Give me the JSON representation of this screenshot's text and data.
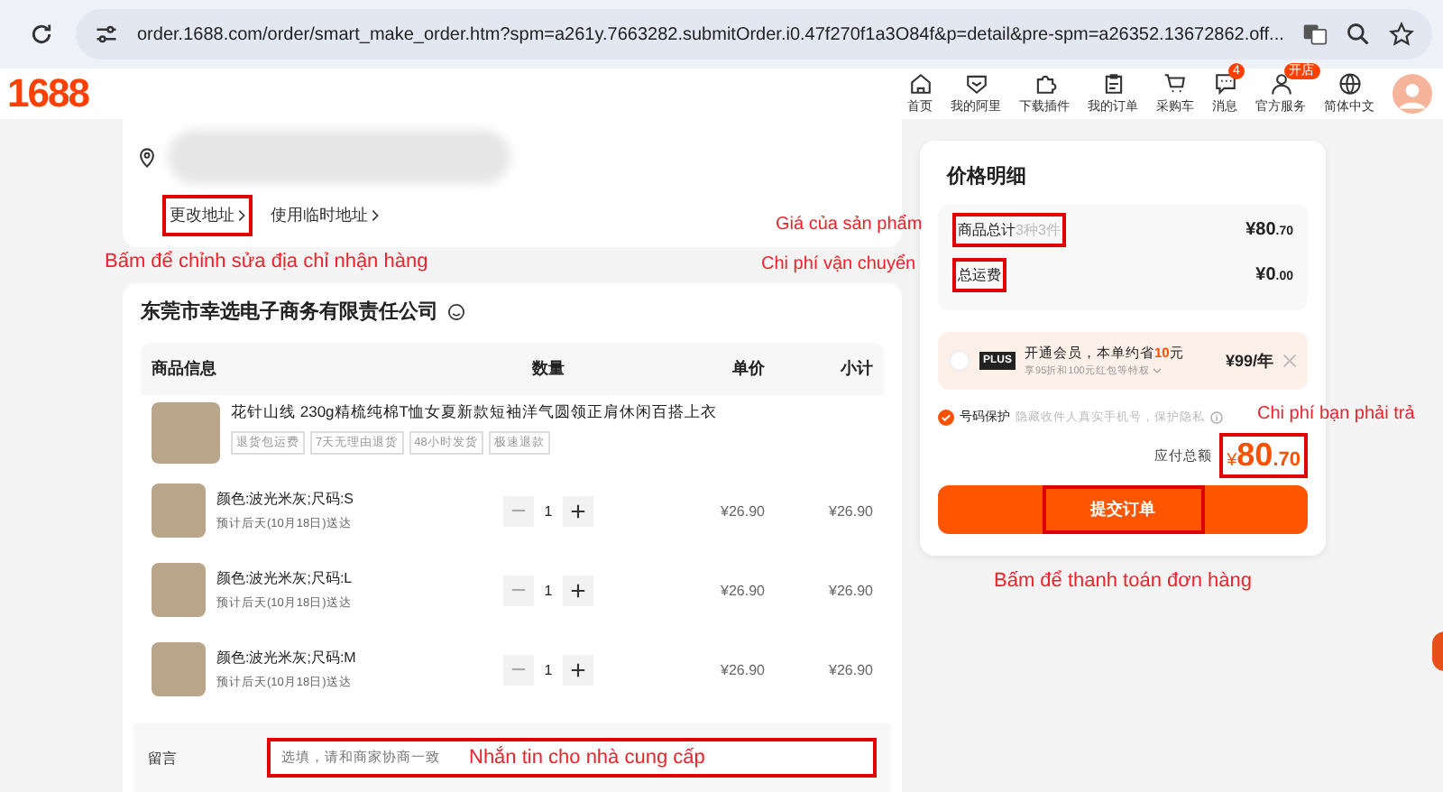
{
  "browser": {
    "url": "order.1688.com/order/smart_make_order.htm?spm=a261y.7663282.submitOrder.i0.47f270f1a3O84f&p=detail&pre-spm=a26352.13672862.off..."
  },
  "header": {
    "logo": "1688",
    "nav": [
      {
        "label": "首页"
      },
      {
        "label": "我的阿里"
      },
      {
        "label": "下载插件"
      },
      {
        "label": "我的订单"
      },
      {
        "label": "采购车"
      },
      {
        "label": "消息",
        "badge": "4"
      },
      {
        "label": "官方服务",
        "badge": "开店"
      },
      {
        "label": "简体中文"
      }
    ]
  },
  "address": {
    "links": [
      {
        "label": "更改地址",
        "highlighted": true
      },
      {
        "label": "使用临时地址",
        "highlighted": false
      }
    ],
    "annotation": "Bấm để chỉnh sửa địa chỉ nhận hàng"
  },
  "store": {
    "name": "东莞市幸选电子商务有限责任公司",
    "columns": [
      "商品信息",
      "数量",
      "单价",
      "小计"
    ],
    "product": {
      "title": "花针山线 230g精梳纯棉T恤女夏新款短袖洋气圆领正肩休闲百搭上衣",
      "tags": [
        "退货包运费",
        "7天无理由退货",
        "48小时发货",
        "极速退款"
      ]
    },
    "items": [
      {
        "variant": "颜色:波光米灰;尺码:S",
        "delivery": "预计后天(10月18日)送达",
        "qty": "1",
        "price": "¥26.90",
        "subtotal": "¥26.90"
      },
      {
        "variant": "颜色:波光米灰;尺码:L",
        "delivery": "预计后天(10月18日)送达",
        "qty": "1",
        "price": "¥26.90",
        "subtotal": "¥26.90"
      },
      {
        "variant": "颜色:波光米灰;尺码:M",
        "delivery": "预计后天(10月18日)送达",
        "qty": "1",
        "price": "¥26.90",
        "subtotal": "¥26.90"
      }
    ],
    "message": {
      "label": "留言",
      "placeholder": "选填，请和商家协商一致",
      "annotation": "Nhắn tin cho nhà cung cấp"
    }
  },
  "summary": {
    "title": "价格明细",
    "rows": [
      {
        "label": "商品总计",
        "note": "3种3件",
        "integer": "¥80",
        "decimal": ".70",
        "highlighted": true,
        "annotation": "Giá của sản phẩm"
      },
      {
        "label": "总运费",
        "integer": "¥0",
        "decimal": ".00",
        "highlighted": true,
        "annotation": "Chi phí vận chuyển"
      }
    ],
    "plus": {
      "selected": false,
      "badge": "PLUS",
      "text": "开通会员，本单约省**10**元",
      "subtext": "享95折和100元红包等特权",
      "price": "¥99/年"
    },
    "protection": {
      "checked": true,
      "label": "号码保护",
      "text": "隐藏收件人真实手机号，保护隐私",
      "annotation": "Chi phí bạn phải trả"
    },
    "total": {
      "label": "应付总额",
      "currency": "¥",
      "integer": "80",
      "decimal": ".70",
      "highlighted": true
    },
    "submit": {
      "label": "提交订单",
      "highlighted": true,
      "annotation": "Bấm để thanh toán đơn hàng"
    }
  }
}
